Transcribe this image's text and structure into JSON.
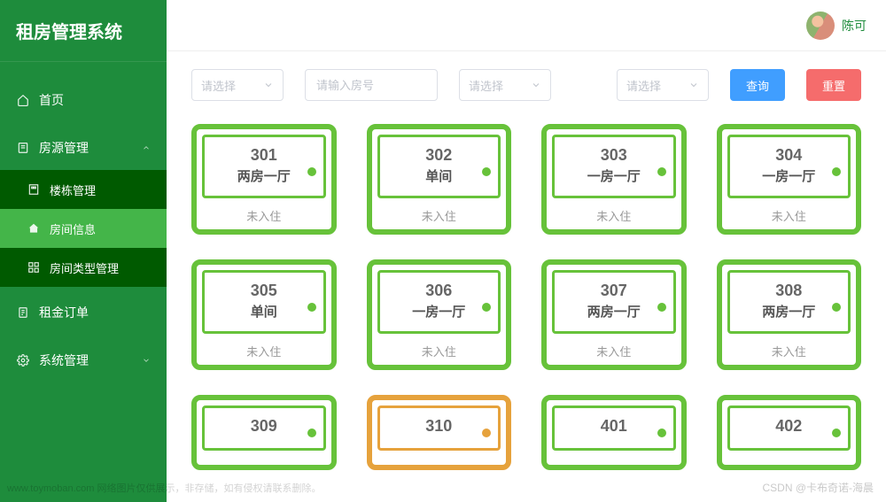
{
  "app": {
    "title": "租房管理系统"
  },
  "user": {
    "name": "陈可"
  },
  "sidebar": {
    "items": [
      {
        "label": "首页"
      },
      {
        "label": "房源管理"
      },
      {
        "label": "租金订单"
      },
      {
        "label": "系统管理"
      }
    ],
    "sub": [
      {
        "label": "楼栋管理"
      },
      {
        "label": "房间信息"
      },
      {
        "label": "房间类型管理"
      }
    ]
  },
  "filters": {
    "select1": "请选择",
    "input_placeholder": "请输入房号",
    "select2": "请选择",
    "select3": "请选择",
    "query": "查询",
    "reset": "重置"
  },
  "rooms": [
    {
      "no": "301",
      "type": "两房一厅",
      "status": "未入住",
      "color": "green"
    },
    {
      "no": "302",
      "type": "单间",
      "status": "未入住",
      "color": "green"
    },
    {
      "no": "303",
      "type": "一房一厅",
      "status": "未入住",
      "color": "green"
    },
    {
      "no": "304",
      "type": "一房一厅",
      "status": "未入住",
      "color": "green"
    },
    {
      "no": "305",
      "type": "单间",
      "status": "未入住",
      "color": "green"
    },
    {
      "no": "306",
      "type": "一房一厅",
      "status": "未入住",
      "color": "green"
    },
    {
      "no": "307",
      "type": "两房一厅",
      "status": "未入住",
      "color": "green"
    },
    {
      "no": "308",
      "type": "两房一厅",
      "status": "未入住",
      "color": "green"
    },
    {
      "no": "309",
      "type": "",
      "status": "",
      "color": "green"
    },
    {
      "no": "310",
      "type": "",
      "status": "",
      "color": "orange"
    },
    {
      "no": "401",
      "type": "",
      "status": "",
      "color": "green"
    },
    {
      "no": "402",
      "type": "",
      "status": "",
      "color": "green"
    }
  ],
  "watermark": {
    "left": "www.toymoban.com 网络图片仅供展示，非存储，如有侵权请联系删除。",
    "right": "CSDN @卡布奇诺-海晨"
  }
}
